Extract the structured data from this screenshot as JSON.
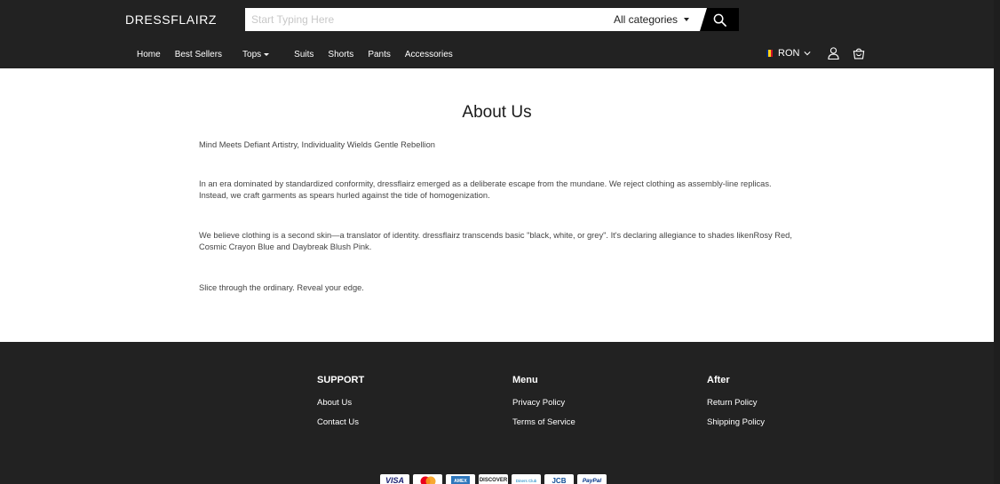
{
  "header": {
    "logo": "DRESSFLAIRZ",
    "search_placeholder": "Start Typing Here",
    "category_label": "All categories",
    "nav": {
      "home": "Home",
      "best_sellers": "Best Sellers",
      "tops": "Tops",
      "suits": "Suits",
      "shorts": "Shorts",
      "pants": "Pants",
      "accessories": "Accessories"
    },
    "currency": "RON",
    "flag_colors": [
      "#002B7F",
      "#FCD116",
      "#CE1126"
    ]
  },
  "content": {
    "title": "About Us",
    "p1": "Mind Meets Defiant Artistry, Individuality Wields Gentle Rebellion",
    "p2": "In an era dominated by standardized conformity, dressflairz emerged as a deliberate escape from the mundane. We reject clothing as assembly-line replicas. Instead, we craft garments as spears hurled against the tide of homogenization.",
    "p3": "We believe clothing is a second skin—a translator of identity. dressflairz transcends basic \"black, white, or grey\". It's declaring allegiance to shades likenRosy Red, Cosmic Crayon Blue and Daybreak Blush Pink.",
    "p4": "Slice through the ordinary. Reveal your edge."
  },
  "footer": {
    "support": {
      "title": "SUPPORT",
      "about": "About Us",
      "contact": "Contact Us"
    },
    "menu": {
      "title": "Menu",
      "privacy": "Privacy Policy",
      "terms": "Terms of Service"
    },
    "after": {
      "title": "After",
      "return": "Return Policy",
      "shipping": "Shipping Policy"
    },
    "payments": {
      "visa": "VISA",
      "amex": "AMEX",
      "discover": "DISCOVER",
      "diners": "Diners Club",
      "jcb": "JCB",
      "paypal": "PayPal"
    }
  }
}
